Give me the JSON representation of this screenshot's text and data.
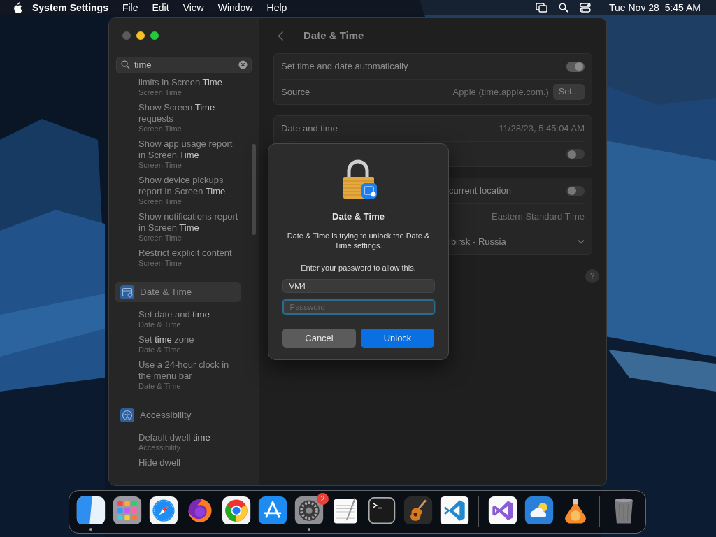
{
  "menu_bar": {
    "app": "System Settings",
    "menus": [
      "File",
      "Edit",
      "View",
      "Window",
      "Help"
    ],
    "clock": "Tue Nov 28  5:45 AM"
  },
  "sidebar": {
    "search": {
      "value": "time"
    },
    "results": [
      {
        "kind": "item",
        "title": "limits in Screen **Time**",
        "subtitle": "Screen Time"
      },
      {
        "kind": "item",
        "title": "Show Screen **Time** requests",
        "subtitle": "Screen Time"
      },
      {
        "kind": "item",
        "title": "Show app usage report in Screen **Time**",
        "subtitle": "Screen Time"
      },
      {
        "kind": "item",
        "title": "Show device pickups report in Screen **Time**",
        "subtitle": "Screen Time"
      },
      {
        "kind": "item",
        "title": "Show notifications report in Screen **Time**",
        "subtitle": "Screen Time"
      },
      {
        "kind": "item",
        "title": "Restrict explicit content",
        "subtitle": "Screen Time"
      },
      {
        "kind": "category",
        "title": "Date & Time",
        "selected": true
      },
      {
        "kind": "item",
        "title": "Set date and **time**",
        "subtitle": "Date & Time"
      },
      {
        "kind": "item",
        "title": "Set **time** zone",
        "subtitle": "Date & Time"
      },
      {
        "kind": "item",
        "title": "Use a 24-hour clock in the menu bar",
        "subtitle": "Date & Time"
      },
      {
        "kind": "category",
        "title": "Accessibility",
        "selected": false
      },
      {
        "kind": "item",
        "title": "Default dwell **time**",
        "subtitle": "Accessibility"
      },
      {
        "kind": "item",
        "title": "Hide dwell"
      }
    ]
  },
  "page": {
    "title": "Date & Time",
    "groups": [
      {
        "rows": [
          {
            "kind": "toggle",
            "label": "Set time and date automatically",
            "on": true
          },
          {
            "kind": "value",
            "label": "Source",
            "value": "Apple (time.apple.com.)",
            "button": "Set..."
          }
        ]
      },
      {
        "rows": [
          {
            "kind": "value",
            "label": "Date and time",
            "value": "11/28/23, 5:45:04 AM"
          },
          {
            "kind": "toggle",
            "on": false
          }
        ]
      },
      {
        "rows": [
          {
            "kind": "toggle",
            "label": "current location",
            "on": false
          },
          {
            "kind": "value",
            "value": "Eastern Standard Time"
          },
          {
            "kind": "dropdown",
            "value": "ibirsk - Russia"
          }
        ]
      }
    ],
    "help": "?"
  },
  "dialog": {
    "title": "Date & Time",
    "message": "Date & Time is trying to unlock the Date & Time settings.",
    "prompt": "Enter your password to allow this.",
    "username": "VM4",
    "password_placeholder": "Password",
    "buttons": [
      {
        "label": "Cancel",
        "kind": "cancel"
      },
      {
        "label": "Unlock",
        "kind": "default"
      }
    ]
  },
  "dock": [
    {
      "kind": "finder",
      "running": true
    },
    {
      "kind": "launchpad",
      "running": false
    },
    {
      "kind": "safari",
      "running": false
    },
    {
      "kind": "firefox",
      "running": false
    },
    {
      "kind": "chrome",
      "running": false
    },
    {
      "kind": "appstore",
      "running": false
    },
    {
      "kind": "settings",
      "running": true,
      "badge": "2"
    },
    {
      "kind": "textedit",
      "running": false
    },
    {
      "kind": "terminal",
      "running": false
    },
    {
      "kind": "guitar",
      "running": false
    },
    {
      "kind": "vscode",
      "running": false
    },
    {
      "kind": "separator"
    },
    {
      "kind": "vstudio",
      "running": false
    },
    {
      "kind": "weather",
      "running": false
    },
    {
      "kind": "installer",
      "running": false
    },
    {
      "kind": "separator"
    },
    {
      "kind": "trash",
      "running": false
    }
  ]
}
